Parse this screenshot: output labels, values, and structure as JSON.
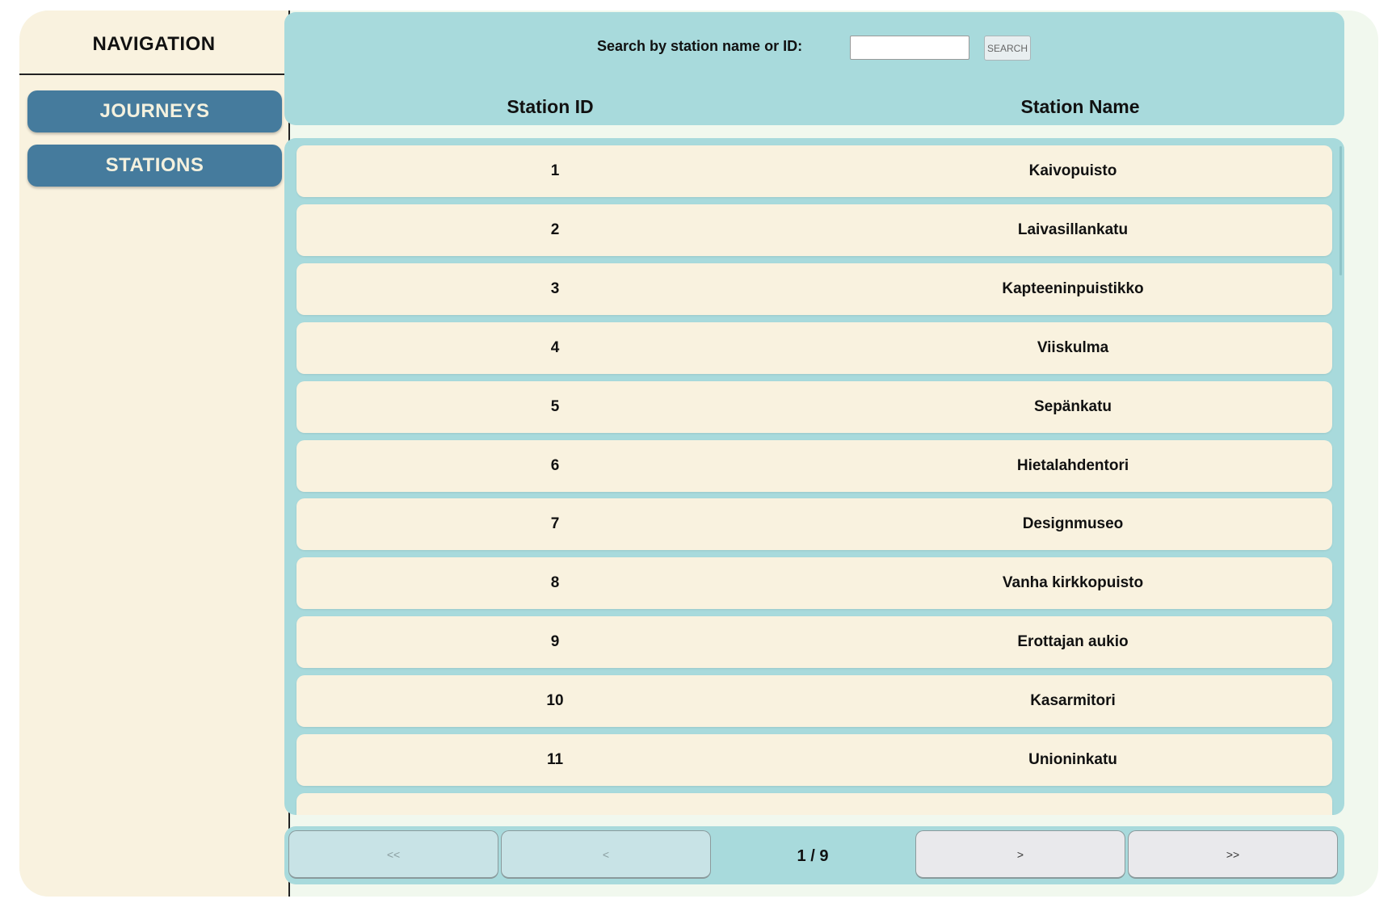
{
  "sidebar": {
    "title": "NAVIGATION",
    "items": [
      {
        "label": "JOURNEYS"
      },
      {
        "label": "STATIONS"
      }
    ]
  },
  "search": {
    "label": "Search by station name or ID:",
    "value": "",
    "placeholder": "",
    "button_label": "SEARCH"
  },
  "table": {
    "columns": [
      "Station ID",
      "Station Name"
    ],
    "rows": [
      {
        "id": "1",
        "name": "Kaivopuisto"
      },
      {
        "id": "2",
        "name": "Laivasillankatu"
      },
      {
        "id": "3",
        "name": "Kapteeninpuistikko"
      },
      {
        "id": "4",
        "name": "Viiskulma"
      },
      {
        "id": "5",
        "name": "Sepänkatu"
      },
      {
        "id": "6",
        "name": "Hietalahdentori"
      },
      {
        "id": "7",
        "name": "Designmuseo"
      },
      {
        "id": "8",
        "name": "Vanha kirkkopuisto"
      },
      {
        "id": "9",
        "name": "Erottajan aukio"
      },
      {
        "id": "10",
        "name": "Kasarmitori"
      },
      {
        "id": "11",
        "name": "Unioninkatu"
      },
      {
        "id": "",
        "name": ""
      }
    ]
  },
  "pagination": {
    "first_label": "<<",
    "prev_label": "<",
    "next_label": ">",
    "last_label": ">>",
    "page_indicator": "1 / 9"
  },
  "colors": {
    "sidebar_bg": "#f9f2df",
    "nav_button": "#457b9d",
    "panel_bg": "#a8dadc",
    "row_bg": "#f9f2df"
  }
}
